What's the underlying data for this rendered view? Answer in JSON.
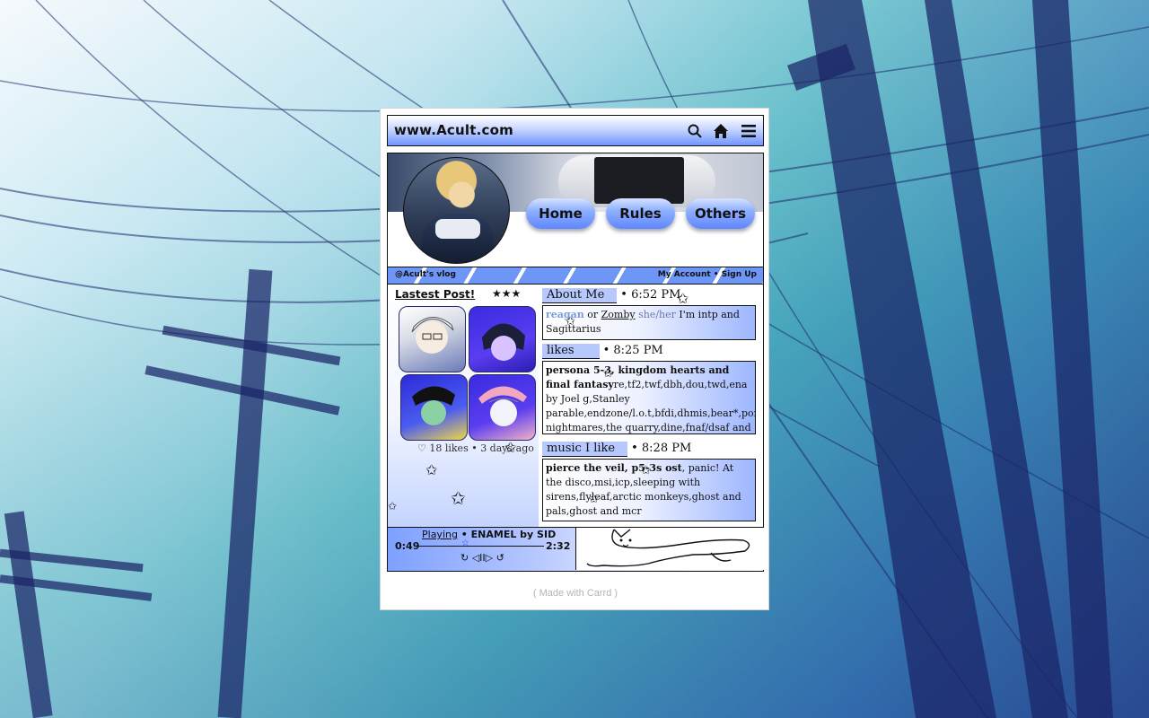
{
  "site": {
    "title": "www.Acult.com",
    "icons": [
      "search-icon",
      "home-icon",
      "menu-icon"
    ]
  },
  "nav": {
    "items": [
      "Home",
      "Rules",
      "Others"
    ]
  },
  "strip": {
    "left": "@Acult's vlog",
    "right": "My Account • Sign Up"
  },
  "latest_post": {
    "heading": "Lastest Post!",
    "rating": "★★★",
    "meta": "♡ 18 likes • 3 days ago"
  },
  "sections": {
    "about": {
      "title": "About Me",
      "time": "• 6:52 PM",
      "name1": "reagan",
      "or": " or ",
      "name2": "Zomby",
      "pronouns": " she/her ",
      "rest": "I'm intp and Sagittarius"
    },
    "likes": {
      "title": "likes",
      "time": "• 8:25 PM",
      "bold": "persona 5-3, kingdom hearts and final fantasy",
      "rest": "re,tf2,twf,dbh,dou,twd,ena by Joel g,Stanley parable,endzone/l.o.t,bfdi,dhmis,bear*,portal, nightmares,the quarry,dine,fnaf/dsaf and silent hill!"
    },
    "music": {
      "title": "music I like",
      "time": "• 8:28 PM",
      "bold": "pierce the veil, p5-3s ost",
      "rest": ", panic! At the disco,msi,icp,sleeping with sirens,flyleaf,arctic monkeys,ghost and pals,ghost and mcr"
    }
  },
  "player": {
    "status": "Playing",
    "track": " • ENAMEL by SID",
    "elapsed": "0:49",
    "duration": "2:32",
    "progress": 0.38,
    "controls": "↻ ◁II▷ ↺"
  },
  "footer": {
    "text": "( Made with Carrd )"
  },
  "colors": {
    "accent": "#6e96f6",
    "chip": "#b7c8ff"
  }
}
